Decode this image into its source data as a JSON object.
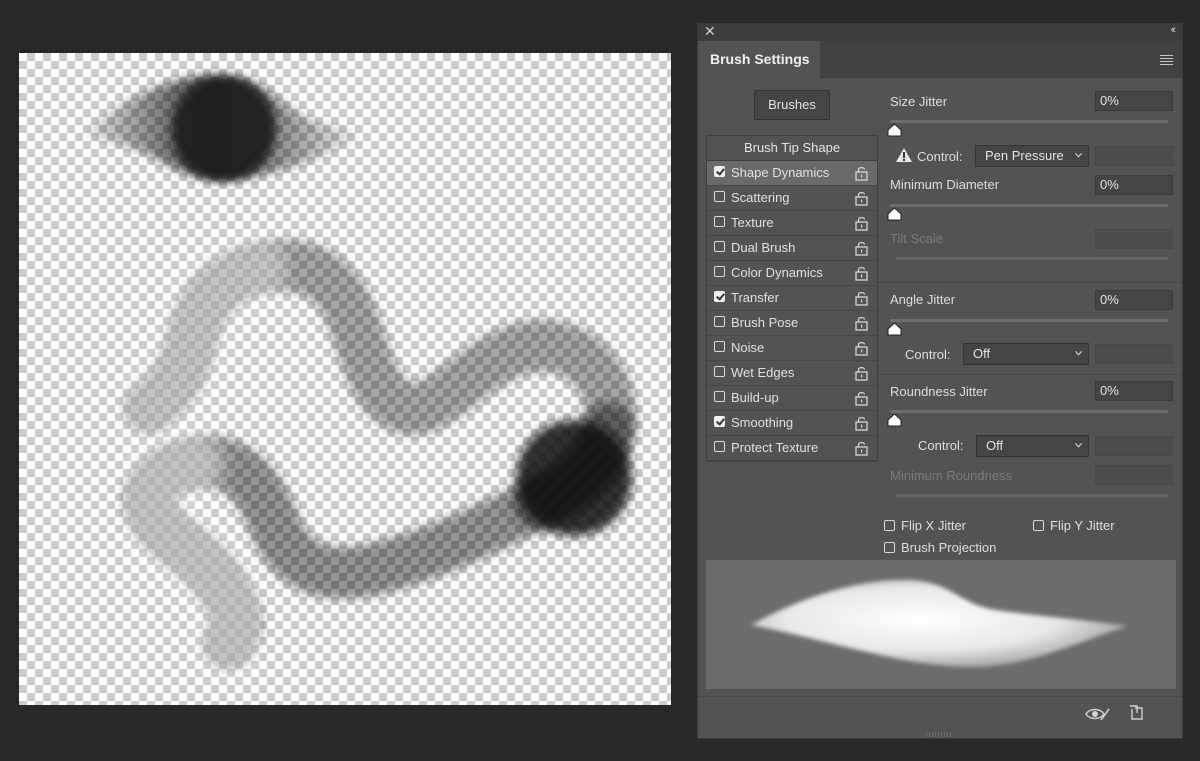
{
  "panel": {
    "close_glyph": "✕",
    "collapse_glyph": "‹‹",
    "tab_title": "Brush Settings",
    "brushes_button": "Brushes"
  },
  "list": {
    "header": "Brush Tip Shape",
    "items": [
      {
        "label": "Shape Dynamics",
        "checked": true,
        "active": true
      },
      {
        "label": "Scattering",
        "checked": false
      },
      {
        "label": "Texture",
        "checked": false
      },
      {
        "label": "Dual Brush",
        "checked": false
      },
      {
        "label": "Color Dynamics",
        "checked": false
      },
      {
        "label": "Transfer",
        "checked": true
      },
      {
        "label": "Brush Pose",
        "checked": false
      },
      {
        "label": "Noise",
        "checked": false
      },
      {
        "label": "Wet Edges",
        "checked": false
      },
      {
        "label": "Build-up",
        "checked": false
      },
      {
        "label": "Smoothing",
        "checked": true
      },
      {
        "label": "Protect Texture",
        "checked": false
      }
    ]
  },
  "settings": {
    "size_jitter": {
      "label": "Size Jitter",
      "value": "0%"
    },
    "size_control": {
      "label": "Control:",
      "value": "Pen Pressure"
    },
    "minimum_diameter": {
      "label": "Minimum Diameter",
      "value": "0%"
    },
    "tilt_scale": {
      "label": "Tilt Scale"
    },
    "angle_jitter": {
      "label": "Angle Jitter",
      "value": "0%"
    },
    "angle_control": {
      "label": "Control:",
      "value": "Off"
    },
    "roundness_jitter": {
      "label": "Roundness Jitter",
      "value": "0%"
    },
    "roundness_control": {
      "label": "Control:",
      "value": "Off"
    },
    "minimum_roundness": {
      "label": "Minimum Roundness"
    },
    "flip_x": {
      "label": "Flip X Jitter",
      "checked": false
    },
    "flip_y": {
      "label": "Flip Y Jitter",
      "checked": false
    },
    "brush_projection": {
      "label": "Brush Projection",
      "checked": false
    }
  },
  "bottom_bar": {
    "icons": [
      "toggle-live-tip-preview-icon",
      "create-new-brush-icon"
    ]
  },
  "colors": {
    "app_background": "#282828",
    "panel_background": "#535353",
    "active_row": "#6a6a6a",
    "preview_background": "#6c6c6c"
  }
}
